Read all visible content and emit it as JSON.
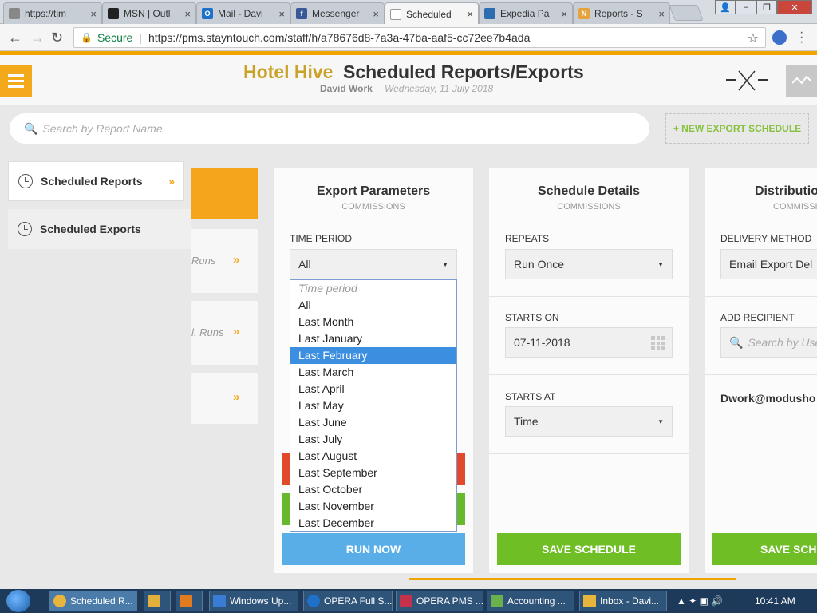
{
  "browser": {
    "tabs": [
      {
        "label": "https://tim",
        "fav": "#888"
      },
      {
        "label": "MSN | Outl",
        "fav": "#222"
      },
      {
        "label": "Mail - Davi",
        "fav": "#1e70c8"
      },
      {
        "label": "Messenger",
        "fav": "#3b5998"
      },
      {
        "label": "Scheduled",
        "fav": "#fff"
      },
      {
        "label": "Expedia Pa",
        "fav": "#2b6db0"
      },
      {
        "label": "Reports - S",
        "fav": "#e6a23c"
      }
    ],
    "secure_label": "Secure",
    "url": "https://pms.stayntouch.com/staff/h/a78676d8-7a3a-47ba-aaf5-cc72ee7b4ada"
  },
  "header": {
    "brand": "Hotel Hive",
    "title": "Scheduled Reports/Exports",
    "user": "David Work",
    "date": "Wednesday, 11 July 2018"
  },
  "search": {
    "placeholder": "Search by Report Name",
    "new_export_label": "+ NEW EXPORT SCHEDULE"
  },
  "sidenav": {
    "reports_label": "Scheduled Reports",
    "exports_label": "Scheduled Exports"
  },
  "list": {
    "runs1": "Runs",
    "runs2": "l. Runs"
  },
  "export_params": {
    "title": "Export Parameters",
    "subtitle": "COMMISSIONS",
    "time_period_label": "TIME PERIOD",
    "time_period_value": "All",
    "run_now_label": "RUN NOW"
  },
  "schedule": {
    "title": "Schedule Details",
    "subtitle": "COMMISSIONS",
    "repeats_label": "REPEATS",
    "repeats_value": "Run Once",
    "starts_on_label": "STARTS ON",
    "starts_on_value": "07-11-2018",
    "starts_at_label": "STARTS AT",
    "starts_at_value": "Time",
    "save_label": "SAVE SCHEDULE"
  },
  "distribution": {
    "title": "Distributio",
    "subtitle": "COMMISSI",
    "delivery_label": "DELIVERY METHOD",
    "delivery_value": "Email Export Del",
    "recipient_label": "ADD RECIPIENT",
    "recipient_placeholder": "Search by Use",
    "recipient_email": "Dwork@modusho",
    "save_label": "SAVE SCHE"
  },
  "dropdown": {
    "options": [
      "Time period",
      "All",
      "Last Month",
      "Last January",
      "Last February",
      "Last March",
      "Last April",
      "Last May",
      "Last June",
      "Last July",
      "Last August",
      "Last September",
      "Last October",
      "Last November",
      "Last December"
    ],
    "selected_index": 4
  },
  "taskbar": {
    "items": [
      {
        "label": "Scheduled R...",
        "color": "#e8b53c"
      },
      {
        "label": "",
        "color": "#e2b13b"
      },
      {
        "label": "",
        "color": "#e07b1f"
      },
      {
        "label": "Windows Up...",
        "color": "#3a7bd5"
      },
      {
        "label": "OPERA Full S...",
        "color": "#1e70c8"
      },
      {
        "label": "OPERA PMS ...",
        "color": "#c4314b"
      },
      {
        "label": "Accounting ...",
        "color": "#6ab04c"
      },
      {
        "label": "Inbox - Davi...",
        "color": "#e8b53c"
      }
    ],
    "time": "10:41 AM"
  }
}
